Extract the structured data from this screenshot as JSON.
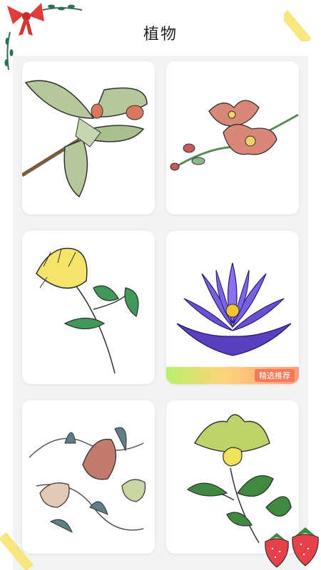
{
  "header": {
    "title": "植物"
  },
  "grid": {
    "items": [
      {
        "name": "leafy-branch"
      },
      {
        "name": "orchid"
      },
      {
        "name": "yellow-flower"
      },
      {
        "name": "purple-lotus",
        "badge": "精选推荐"
      },
      {
        "name": "protea-sprigs"
      },
      {
        "name": "green-lotus-flower"
      }
    ]
  },
  "colors": {
    "accent_badge": "#f4795a",
    "panel_bg": "#f3f3f3",
    "ribbon": "#e23b3b",
    "tape": "#f6e36b",
    "strawberry": "#e8404a"
  }
}
